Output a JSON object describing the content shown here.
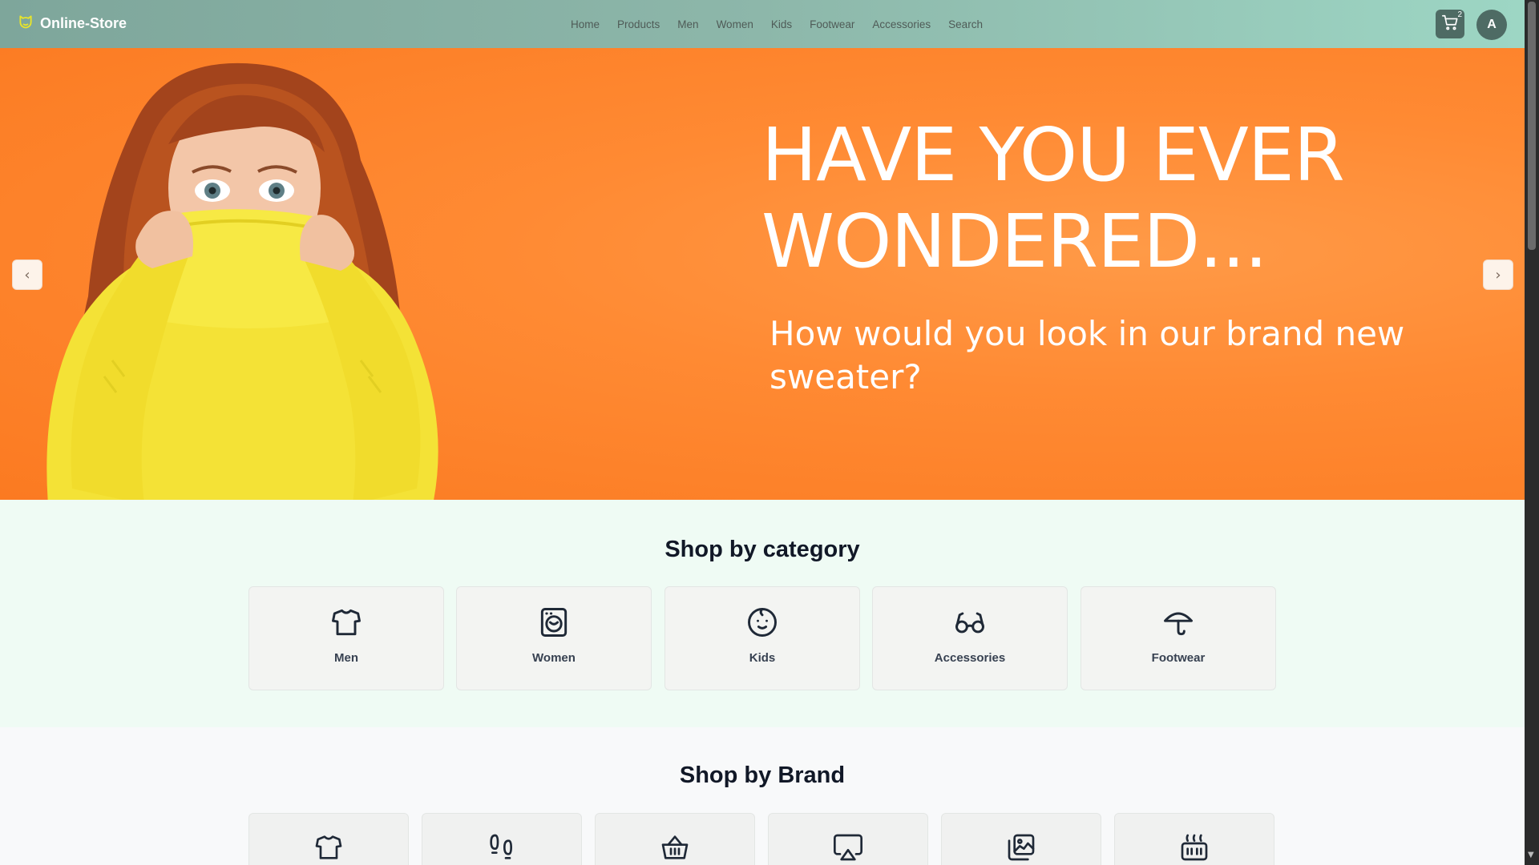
{
  "navbar": {
    "brand_name": "Online-Store",
    "brand_icon": "cat-shield-icon",
    "links": [
      "Home",
      "Products",
      "Men",
      "Women",
      "Kids",
      "Footwear",
      "Accessories",
      "Search"
    ],
    "cart_count": "2",
    "avatar_initial": "A"
  },
  "hero": {
    "heading_line1": "HAVE YOU EVER",
    "heading_line2": "WONDERED...",
    "subheading": "How would you look in our brand new sweater?",
    "prev_icon": "chevron-left-icon",
    "next_icon": "chevron-right-icon"
  },
  "categories": {
    "title": "Shop by category",
    "items": [
      {
        "label": "Men",
        "icon": "shirt-icon"
      },
      {
        "label": "Women",
        "icon": "washing-machine-icon"
      },
      {
        "label": "Kids",
        "icon": "baby-face-icon"
      },
      {
        "label": "Accessories",
        "icon": "glasses-icon"
      },
      {
        "label": "Footwear",
        "icon": "umbrella-icon"
      }
    ]
  },
  "brands": {
    "title": "Shop by Brand",
    "items": [
      {
        "icon": "shirt-icon"
      },
      {
        "icon": "footprints-icon"
      },
      {
        "icon": "basket-icon"
      },
      {
        "icon": "airplay-icon"
      },
      {
        "icon": "image-gallery-icon"
      },
      {
        "icon": "grill-icon"
      }
    ]
  },
  "colors": {
    "hero_orange": "#fb7a21",
    "navbar_green": "#8db7aa",
    "brand_icon_yellow": "#e8e52a"
  }
}
